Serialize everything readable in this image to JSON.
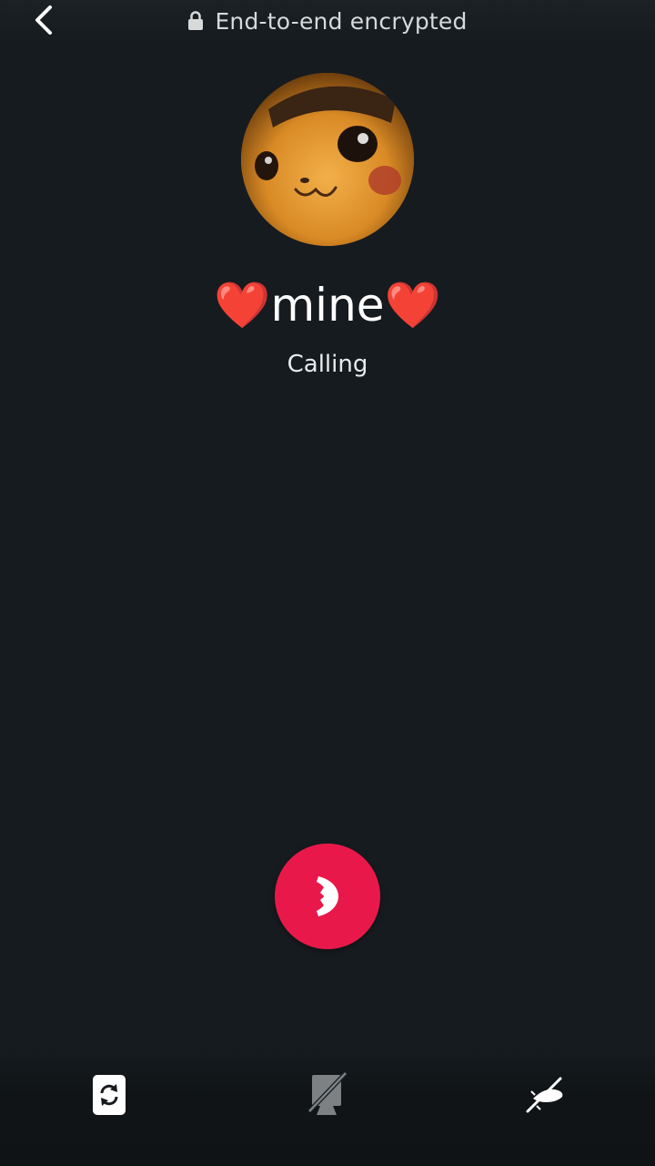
{
  "header": {
    "back_icon": "chevron-left-icon",
    "lock_icon": "lock-icon",
    "encryption_text": "End-to-end encrypted"
  },
  "contact": {
    "name": "❤️mine❤️",
    "status": "Calling",
    "avatar_icon": "profile-photo"
  },
  "controls": {
    "end_call_icon": "phone-hangup-icon",
    "end_call_color": "#e8194a",
    "switch_camera_icon": "switch-camera-icon",
    "video_off_icon": "video-off-icon",
    "mute_icon": "mic-off-icon"
  },
  "colors": {
    "background": "#161b1f",
    "text": "#ffffff",
    "muted_icon": "#7d8184"
  }
}
